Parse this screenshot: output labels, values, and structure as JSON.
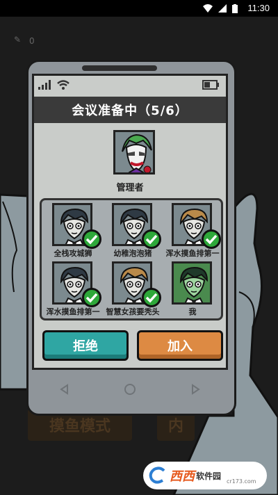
{
  "status_bar": {
    "time": "11:30"
  },
  "background": {
    "pen_count": "0",
    "mode_button": "摸鱼模式",
    "other_button": "内"
  },
  "dialog": {
    "title": "会议准备中（5/6）",
    "admin_label": "管理者",
    "players": [
      {
        "name": "全栈攻城狮",
        "ready": true,
        "hair": "dark"
      },
      {
        "name": "幼稚泡泡猪",
        "ready": true,
        "hair": "dark"
      },
      {
        "name": "浑水摸鱼排第一",
        "ready": true,
        "hair": "blond"
      },
      {
        "name": "浑水摸鱼排第一",
        "ready": true,
        "hair": "dark"
      },
      {
        "name": "智慧女孩要秃头",
        "ready": true,
        "hair": "blond"
      },
      {
        "name": "我",
        "ready": false,
        "hair": "dark-green"
      }
    ],
    "reject_label": "拒绝",
    "join_label": "加入"
  },
  "watermark": {
    "brand": "西西",
    "site": "软件园",
    "url": "cr173.com"
  },
  "colors": {
    "reject": "#2fa6a3",
    "join": "#dd8a43",
    "ready_check": "#2ea83a",
    "screen_bg": "#c9ccc9"
  }
}
